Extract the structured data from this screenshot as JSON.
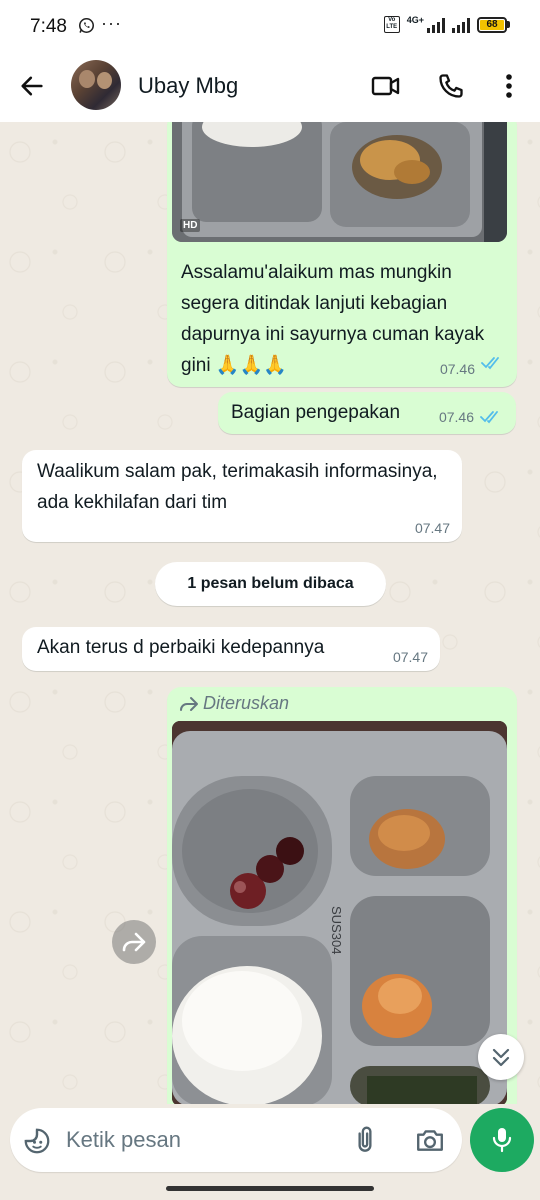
{
  "status_bar": {
    "time": "7:48",
    "volte_label": "Vo LTE",
    "network_label": "4G+",
    "battery_level": "68",
    "battery_color": "#f2c200"
  },
  "header": {
    "contact_name": "Ubay Mbg",
    "icons": [
      "back-arrow-icon",
      "video-call-icon",
      "phone-icon",
      "more-vert-icon"
    ]
  },
  "messages": [
    {
      "direction": "outgoing",
      "type": "image",
      "hd_badge": "HD",
      "caption": "Assalamu'alaikum mas mungkin segera ditindak lanjuti kebagian dapurnya ini sayurnya cuman kayak gini 🙏🙏🙏",
      "time": "07.46",
      "status": "read"
    },
    {
      "direction": "outgoing",
      "type": "text",
      "text": "Bagian pengepakan",
      "time": "07.46",
      "status": "read"
    },
    {
      "direction": "incoming",
      "type": "text",
      "text": "Waalikum salam pak, terimakasih informasinya, ada kekhilafan dari tim",
      "time": "07.47"
    },
    {
      "direction": "incoming",
      "type": "text",
      "text": "Akan terus d perbaiki kedepannya",
      "time": "07.47"
    },
    {
      "direction": "outgoing",
      "type": "image",
      "forwarded_label": "Diteruskan",
      "tray_stamp": "SUS304"
    }
  ],
  "unread_divider": "1 pesan belum dibaca",
  "composer": {
    "placeholder": "Ketik pesan",
    "icons": [
      "sticker-icon",
      "attach-icon",
      "camera-icon",
      "mic-icon"
    ]
  },
  "colors": {
    "outgoing_bubble": "#d9fdd3",
    "incoming_bubble": "#ffffff",
    "read_ticks": "#53bdeb",
    "mic_button": "#1daa61",
    "chat_background": "#efeae2"
  }
}
